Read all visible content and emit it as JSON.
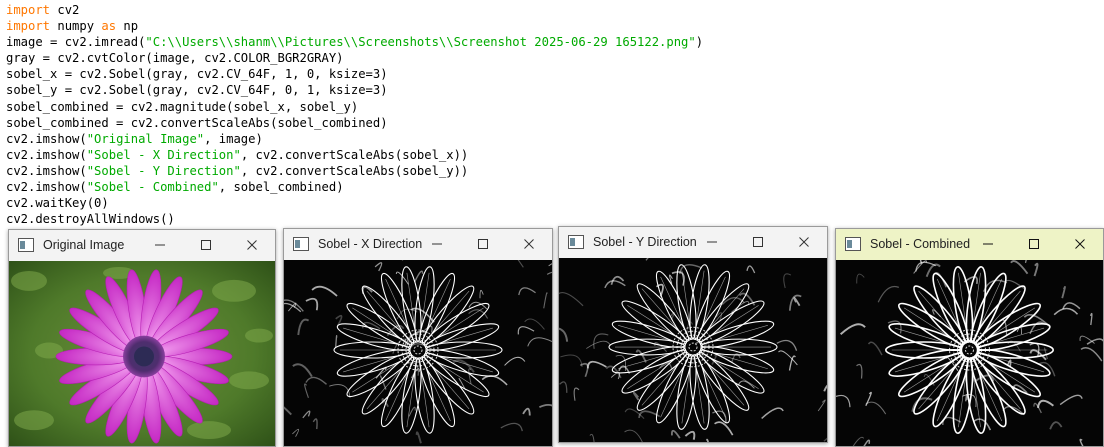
{
  "code": {
    "lines": [
      [
        {
          "t": "import",
          "c": "kw"
        },
        {
          "t": " cv2"
        }
      ],
      [
        {
          "t": "import",
          "c": "kw"
        },
        {
          "t": " numpy "
        },
        {
          "t": "as",
          "c": "kw"
        },
        {
          "t": " np"
        }
      ],
      [
        {
          "t": "image = cv2.imread("
        },
        {
          "t": "\"C:\\\\Users\\\\shanm\\\\Pictures\\\\Screenshots\\\\Screenshot 2025-06-29 165122.png\"",
          "c": "str"
        },
        {
          "t": ")"
        }
      ],
      [
        {
          "t": "gray = cv2.cvtColor(image, cv2.COLOR_BGR2GRAY)"
        }
      ],
      [
        {
          "t": "sobel_x = cv2.Sobel(gray, cv2.CV_64F, 1, 0, ksize=3)"
        }
      ],
      [
        {
          "t": "sobel_y = cv2.Sobel(gray, cv2.CV_64F, 0, 1, ksize=3)"
        }
      ],
      [
        {
          "t": "sobel_combined = cv2.magnitude(sobel_x, sobel_y)"
        }
      ],
      [
        {
          "t": "sobel_combined = cv2.convertScaleAbs(sobel_combined)"
        }
      ],
      [
        {
          "t": "cv2.imshow("
        },
        {
          "t": "\"Original Image\"",
          "c": "str"
        },
        {
          "t": ", image)"
        }
      ],
      [
        {
          "t": "cv2.imshow("
        },
        {
          "t": "\"Sobel - X Direction\"",
          "c": "str"
        },
        {
          "t": ", cv2.convertScaleAbs(sobel_x))"
        }
      ],
      [
        {
          "t": "cv2.imshow("
        },
        {
          "t": "\"Sobel - Y Direction\"",
          "c": "str"
        },
        {
          "t": ", cv2.convertScaleAbs(sobel_y))"
        }
      ],
      [
        {
          "t": "cv2.imshow("
        },
        {
          "t": "\"Sobel - Combined\"",
          "c": "str"
        },
        {
          "t": ", sobel_combined)"
        }
      ],
      [
        {
          "t": "cv2.waitKey(0)"
        }
      ],
      [
        {
          "t": "cv2.destroyAllWindows()"
        }
      ]
    ]
  },
  "colors": {
    "keyword": "#ff7700",
    "string": "#00aa00",
    "active_titlebar": "#eef3c6"
  },
  "windows": {
    "original": {
      "title": "Original Image",
      "image": "purple-daisy-photo"
    },
    "sobel_x": {
      "title": "Sobel - X Direction",
      "image": "sobel-x-edge-map"
    },
    "sobel_y": {
      "title": "Sobel - Y Direction",
      "image": "sobel-y-edge-map"
    },
    "combined": {
      "title": "Sobel - Combined",
      "image": "sobel-combined-edge-map"
    }
  },
  "window_controls": [
    "minimize-icon",
    "maximize-icon",
    "close-icon"
  ]
}
